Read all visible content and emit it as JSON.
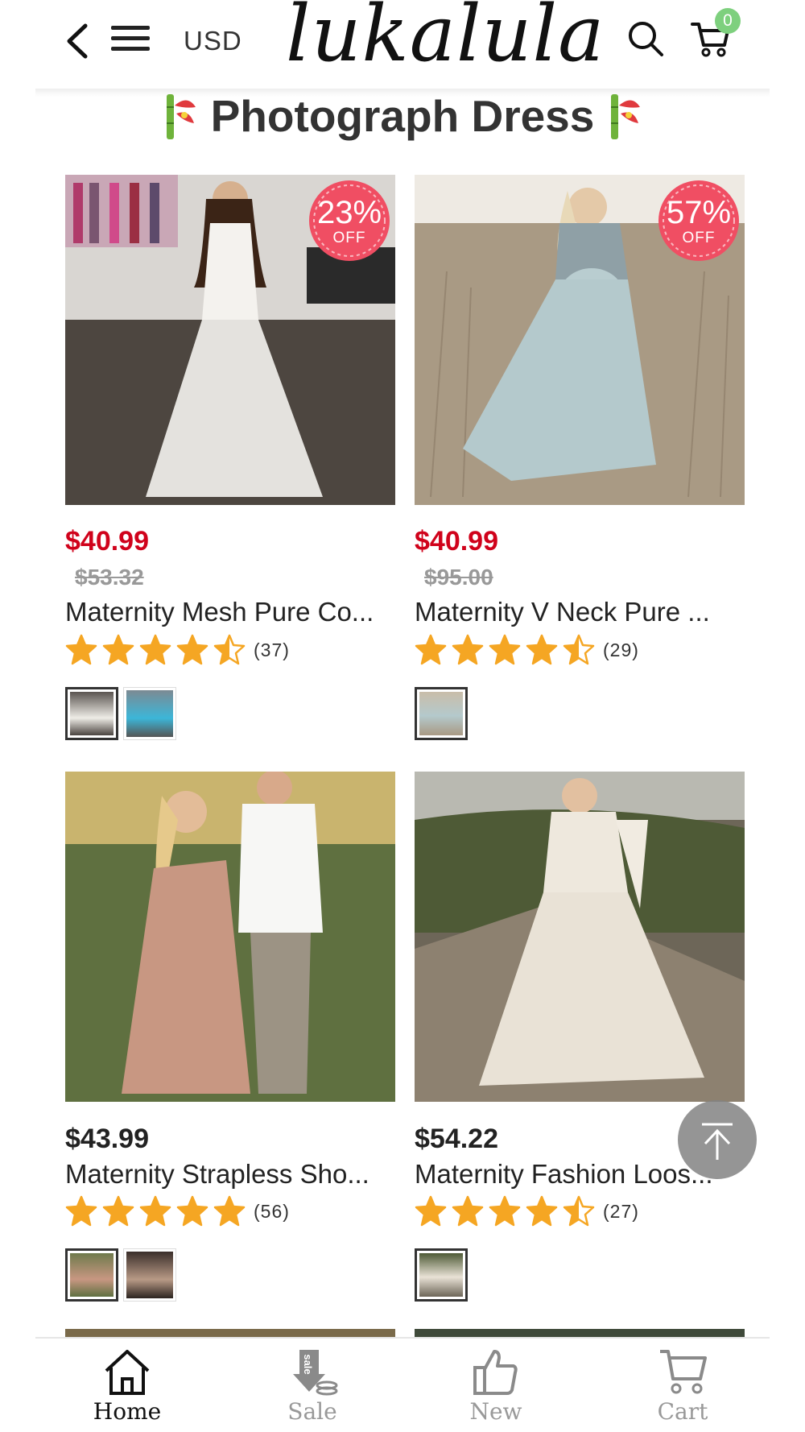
{
  "header": {
    "currency": "USD",
    "logo": "lukalula",
    "cart_count": "0"
  },
  "section": {
    "title": "Photograph Dress"
  },
  "products": [
    {
      "price": "$40.99",
      "old_price": "$53.32",
      "name": "Maternity Mesh Pure Co...",
      "rating": 4.5,
      "review_count": "(37)",
      "discount_pct": "23%",
      "discount_label": "OFF",
      "on_sale": true,
      "swatch_count": 2
    },
    {
      "price": "$40.99",
      "old_price": "$95.00",
      "name": "Maternity V Neck Pure ...",
      "rating": 4.5,
      "review_count": "(29)",
      "discount_pct": "57%",
      "discount_label": "OFF",
      "on_sale": true,
      "swatch_count": 1
    },
    {
      "price": "$43.99",
      "name": "Maternity Strapless Sho...",
      "rating": 5,
      "review_count": "(56)",
      "on_sale": false,
      "swatch_count": 2
    },
    {
      "price": "$54.22",
      "name": "Maternity Fashion Loos...",
      "rating": 4.5,
      "review_count": "(27)",
      "on_sale": false,
      "swatch_count": 1
    }
  ],
  "bottom_nav": {
    "items": [
      {
        "label": "Home",
        "icon": "home-icon",
        "active": true
      },
      {
        "label": "Sale",
        "icon": "sale-tag-icon",
        "active": false
      },
      {
        "label": "New",
        "icon": "thumbs-up-icon",
        "active": false
      },
      {
        "label": "Cart",
        "icon": "cart-icon",
        "active": false
      }
    ]
  },
  "colors": {
    "sale_price": "#d0021b",
    "badge": "#f04e63",
    "star": "#f5a623",
    "cart_badge": "#7ed07e"
  }
}
